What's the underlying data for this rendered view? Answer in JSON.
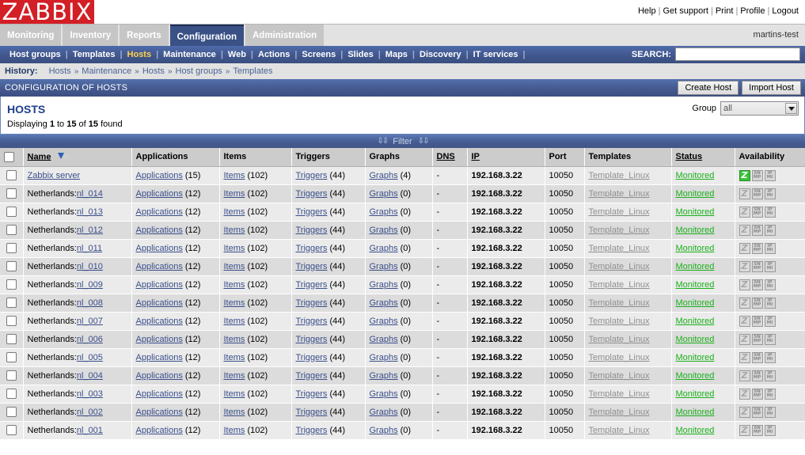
{
  "brand": {
    "logo": "ZABBIX"
  },
  "toplinks": [
    {
      "label": "Help"
    },
    {
      "label": "Get support"
    },
    {
      "label": "Print"
    },
    {
      "label": "Profile"
    },
    {
      "label": "Logout"
    }
  ],
  "mainmenu": {
    "tabs": [
      {
        "label": "Monitoring",
        "active": false
      },
      {
        "label": "Inventory",
        "active": false
      },
      {
        "label": "Reports",
        "active": false
      },
      {
        "label": "Configuration",
        "active": true
      },
      {
        "label": "Administration",
        "active": false
      }
    ],
    "username": "martins-test"
  },
  "submenu": {
    "items": [
      {
        "label": "Host groups",
        "selected": false
      },
      {
        "label": "Templates",
        "selected": false
      },
      {
        "label": "Hosts",
        "selected": true
      },
      {
        "label": "Maintenance",
        "selected": false
      },
      {
        "label": "Web",
        "selected": false
      },
      {
        "label": "Actions",
        "selected": false
      },
      {
        "label": "Screens",
        "selected": false
      },
      {
        "label": "Slides",
        "selected": false
      },
      {
        "label": "Maps",
        "selected": false
      },
      {
        "label": "Discovery",
        "selected": false
      },
      {
        "label": "IT services",
        "selected": false
      }
    ],
    "search_label": "SEARCH:",
    "search_value": "",
    "search_placeholder": ""
  },
  "history": {
    "label": "History:",
    "items": [
      "Hosts",
      "Maintenance",
      "Hosts",
      "Host groups",
      "Templates"
    ],
    "separator": "»"
  },
  "pageheader": {
    "title": "CONFIGURATION OF HOSTS",
    "create_button": "Create Host",
    "import_button": "Import Host"
  },
  "panel": {
    "title": "HOSTS",
    "displaying_prefix": "Displaying ",
    "displaying_from": "1",
    "displaying_mid": " to ",
    "displaying_to": "15",
    "displaying_of": " of ",
    "displaying_total": "15",
    "displaying_suffix": " found",
    "group_label": "Group",
    "group_value": "all",
    "group_options": [
      "all"
    ]
  },
  "filterbar": {
    "label": "Filter",
    "chevron": "»"
  },
  "table": {
    "columns": [
      {
        "label": "Name",
        "sortable": true,
        "sorted": true
      },
      {
        "label": "Applications",
        "sortable": false
      },
      {
        "label": "Items",
        "sortable": false
      },
      {
        "label": "Triggers",
        "sortable": false
      },
      {
        "label": "Graphs",
        "sortable": false
      },
      {
        "label": "DNS",
        "sortable": true
      },
      {
        "label": "IP",
        "sortable": true
      },
      {
        "label": "Port",
        "sortable": false
      },
      {
        "label": "Templates",
        "sortable": false
      },
      {
        "label": "Status",
        "sortable": true
      },
      {
        "label": "Availability",
        "sortable": false
      }
    ],
    "link_labels": {
      "applications": "Applications",
      "items": "Items",
      "triggers": "Triggers",
      "graphs": "Graphs"
    },
    "rows": [
      {
        "name_prefix": "",
        "name_link": "Zabbix server",
        "applications": "15",
        "items": "102",
        "triggers": "44",
        "graphs": "4",
        "dns": "-",
        "ip": "192.168.3.22",
        "port": "10050",
        "template": "Template_Linux",
        "status": "Monitored",
        "agent_available": true,
        "snmp_label": "SNMP",
        "ipmi_label": "IPMI"
      },
      {
        "name_prefix": "Netherlands:",
        "name_link": "nl_014",
        "applications": "12",
        "items": "102",
        "triggers": "44",
        "graphs": "0",
        "dns": "-",
        "ip": "192.168.3.22",
        "port": "10050",
        "template": "Template_Linux",
        "status": "Monitored",
        "agent_available": false,
        "snmp_label": "SNMP",
        "ipmi_label": "IPMI"
      },
      {
        "name_prefix": "Netherlands:",
        "name_link": "nl_013",
        "applications": "12",
        "items": "102",
        "triggers": "44",
        "graphs": "0",
        "dns": "-",
        "ip": "192.168.3.22",
        "port": "10050",
        "template": "Template_Linux",
        "status": "Monitored",
        "agent_available": false,
        "snmp_label": "SNMP",
        "ipmi_label": "IPMI"
      },
      {
        "name_prefix": "Netherlands:",
        "name_link": "nl_012",
        "applications": "12",
        "items": "102",
        "triggers": "44",
        "graphs": "0",
        "dns": "-",
        "ip": "192.168.3.22",
        "port": "10050",
        "template": "Template_Linux",
        "status": "Monitored",
        "agent_available": false,
        "snmp_label": "SNMP",
        "ipmi_label": "IPMI"
      },
      {
        "name_prefix": "Netherlands:",
        "name_link": "nl_011",
        "applications": "12",
        "items": "102",
        "triggers": "44",
        "graphs": "0",
        "dns": "-",
        "ip": "192.168.3.22",
        "port": "10050",
        "template": "Template_Linux",
        "status": "Monitored",
        "agent_available": false,
        "snmp_label": "SNMP",
        "ipmi_label": "IPMI"
      },
      {
        "name_prefix": "Netherlands:",
        "name_link": "nl_010",
        "applications": "12",
        "items": "102",
        "triggers": "44",
        "graphs": "0",
        "dns": "-",
        "ip": "192.168.3.22",
        "port": "10050",
        "template": "Template_Linux",
        "status": "Monitored",
        "agent_available": false,
        "snmp_label": "SNMP",
        "ipmi_label": "IPMI"
      },
      {
        "name_prefix": "Netherlands:",
        "name_link": "nl_009",
        "applications": "12",
        "items": "102",
        "triggers": "44",
        "graphs": "0",
        "dns": "-",
        "ip": "192.168.3.22",
        "port": "10050",
        "template": "Template_Linux",
        "status": "Monitored",
        "agent_available": false,
        "snmp_label": "SNMP",
        "ipmi_label": "IPMI"
      },
      {
        "name_prefix": "Netherlands:",
        "name_link": "nl_008",
        "applications": "12",
        "items": "102",
        "triggers": "44",
        "graphs": "0",
        "dns": "-",
        "ip": "192.168.3.22",
        "port": "10050",
        "template": "Template_Linux",
        "status": "Monitored",
        "agent_available": false,
        "snmp_label": "SNMP",
        "ipmi_label": "IPMI"
      },
      {
        "name_prefix": "Netherlands:",
        "name_link": "nl_007",
        "applications": "12",
        "items": "102",
        "triggers": "44",
        "graphs": "0",
        "dns": "-",
        "ip": "192.168.3.22",
        "port": "10050",
        "template": "Template_Linux",
        "status": "Monitored",
        "agent_available": false,
        "snmp_label": "SNMP",
        "ipmi_label": "IPMI"
      },
      {
        "name_prefix": "Netherlands:",
        "name_link": "nl_006",
        "applications": "12",
        "items": "102",
        "triggers": "44",
        "graphs": "0",
        "dns": "-",
        "ip": "192.168.3.22",
        "port": "10050",
        "template": "Template_Linux",
        "status": "Monitored",
        "agent_available": false,
        "snmp_label": "SNMP",
        "ipmi_label": "IPMI"
      },
      {
        "name_prefix": "Netherlands:",
        "name_link": "nl_005",
        "applications": "12",
        "items": "102",
        "triggers": "44",
        "graphs": "0",
        "dns": "-",
        "ip": "192.168.3.22",
        "port": "10050",
        "template": "Template_Linux",
        "status": "Monitored",
        "agent_available": false,
        "snmp_label": "SNMP",
        "ipmi_label": "IPMI"
      },
      {
        "name_prefix": "Netherlands:",
        "name_link": "nl_004",
        "applications": "12",
        "items": "102",
        "triggers": "44",
        "graphs": "0",
        "dns": "-",
        "ip": "192.168.3.22",
        "port": "10050",
        "template": "Template_Linux",
        "status": "Monitored",
        "agent_available": false,
        "snmp_label": "SNMP",
        "ipmi_label": "IPMI"
      },
      {
        "name_prefix": "Netherlands:",
        "name_link": "nl_003",
        "applications": "12",
        "items": "102",
        "triggers": "44",
        "graphs": "0",
        "dns": "-",
        "ip": "192.168.3.22",
        "port": "10050",
        "template": "Template_Linux",
        "status": "Monitored",
        "agent_available": false,
        "snmp_label": "SNMP",
        "ipmi_label": "IPMI"
      },
      {
        "name_prefix": "Netherlands:",
        "name_link": "nl_002",
        "applications": "12",
        "items": "102",
        "triggers": "44",
        "graphs": "0",
        "dns": "-",
        "ip": "192.168.3.22",
        "port": "10050",
        "template": "Template_Linux",
        "status": "Monitored",
        "agent_available": false,
        "snmp_label": "SNMP",
        "ipmi_label": "IPMI"
      },
      {
        "name_prefix": "Netherlands:",
        "name_link": "nl_001",
        "applications": "12",
        "items": "102",
        "triggers": "44",
        "graphs": "0",
        "dns": "-",
        "ip": "192.168.3.22",
        "port": "10050",
        "template": "Template_Linux",
        "status": "Monitored",
        "agent_available": false,
        "snmp_label": "SNMP",
        "ipmi_label": "IPMI"
      }
    ]
  },
  "colors": {
    "brand_red": "#d31f26",
    "nav_blue": "#3a5186",
    "active_link": "#ffd24a",
    "status_green": "#1bb01b",
    "available_green": "#38c23a"
  }
}
